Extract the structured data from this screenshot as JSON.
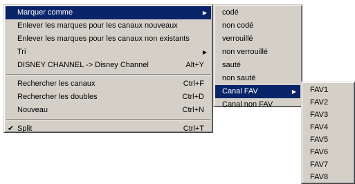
{
  "main_menu": {
    "items": [
      {
        "label": "Marquer comme",
        "shortcut": "",
        "arrow": "▶",
        "check": ""
      },
      {
        "label": "Enlever les marques pour les canaux nouveaux",
        "shortcut": "",
        "arrow": "",
        "check": ""
      },
      {
        "label": "Enlever les marques pour les canaux non existants",
        "shortcut": "",
        "arrow": "",
        "check": ""
      },
      {
        "label": "Tri",
        "shortcut": "",
        "arrow": "▶",
        "check": ""
      },
      {
        "label": "DISNEY CHANNEL -> Disney Channel",
        "shortcut": "Alt+Y",
        "arrow": "",
        "check": ""
      },
      {
        "label": "Rechercher les canaux",
        "shortcut": "Ctrl+F",
        "arrow": "",
        "check": ""
      },
      {
        "label": "Rechercher les doubles",
        "shortcut": "Ctrl+D",
        "arrow": "",
        "check": ""
      },
      {
        "label": "Nouveau",
        "shortcut": "Ctrl+N",
        "arrow": "",
        "check": ""
      },
      {
        "label": "Split",
        "shortcut": "Ctrl+T",
        "arrow": "",
        "check": "✔"
      }
    ]
  },
  "marquer_submenu": {
    "items": [
      {
        "label": "codé",
        "arrow": ""
      },
      {
        "label": "non codé",
        "arrow": ""
      },
      {
        "label": "verrouillé",
        "arrow": ""
      },
      {
        "label": "non verrouillé",
        "arrow": ""
      },
      {
        "label": "sauté",
        "arrow": ""
      },
      {
        "label": "non sauté",
        "arrow": ""
      },
      {
        "label": "Canal FAV",
        "arrow": "▶"
      },
      {
        "label": "Canal non FAV",
        "arrow": ""
      }
    ]
  },
  "fav_submenu": {
    "items": [
      "FAV1",
      "FAV2",
      "FAV3",
      "FAV4",
      "FAV5",
      "FAV6",
      "FAV7",
      "FAV8"
    ]
  },
  "colors": {
    "menu_bg": "#d4d0c8",
    "highlight_bg": "#0a246a",
    "highlight_text": "#ffffff"
  }
}
